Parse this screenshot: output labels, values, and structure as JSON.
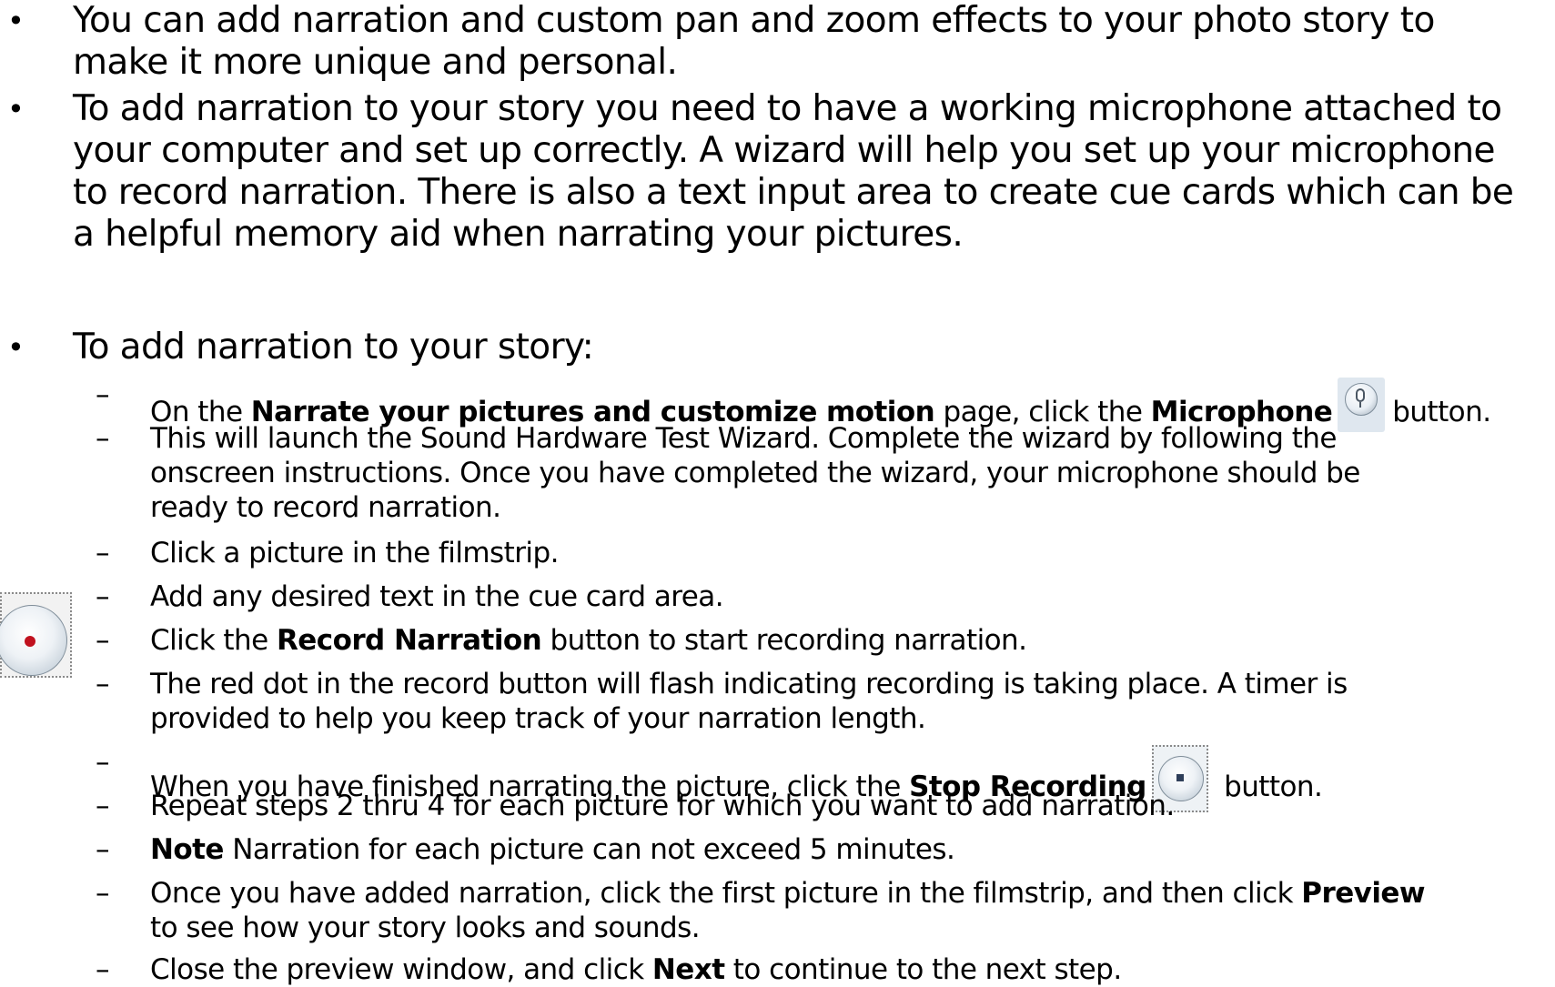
{
  "bullets_l1": [
    "You can add narration and custom pan and zoom effects to your photo story to\nmake it more unique and personal.",
    "To add narration to your story you need to have a working microphone attached to\nyour computer and set up correctly. A wizard will help you set up your microphone\nto record narration. There is also a text input area to create cue cards which can be\na helpful memory aid when narrating your pictures.",
    "To add narration to your story:"
  ],
  "bullet_symbol": "•",
  "dash_symbol": "–",
  "steps": {
    "s1": {
      "t1": "On the ",
      "b1": "Narrate your pictures and customize motion",
      "t2": " page, click the ",
      "b2": "Microphone",
      "t3": "button."
    },
    "s2": {
      "t1": "This will launch the Sound Hardware Test Wizard. Complete the wizard by following the\nonscreen instructions. Once you have completed the wizard, your microphone should be\nready to record narration."
    },
    "s3": {
      "t1": "Click a picture in the filmstrip."
    },
    "s4": {
      "t1": "Add any desired text in the cue card area."
    },
    "s5": {
      "t1": "Click the ",
      "b1": "Record Narration",
      "t2": "  button to start recording narration."
    },
    "s6": {
      "t1": "The red dot in the record button will flash indicating recording is taking place. A timer is\nprovided to help you keep track of your narration length."
    },
    "s7": {
      "t1": "When you have finished narrating the picture, click the ",
      "b1": "Stop Recording",
      "t2": " button."
    },
    "s8": {
      "t1": "Repeat steps 2 thru 4 for each picture for which you want to add narration."
    },
    "s9": {
      "b1": "Note",
      "t1": "   Narration for each picture can not exceed 5 minutes."
    },
    "s10": {
      "t1": "Once you have added narration, click the first picture in the filmstrip, and then click ",
      "b1": "Preview",
      "t2": "\nto see how your story looks and sounds."
    },
    "s11": {
      "t1": "Close the preview window, and click ",
      "b1": "Next",
      "t2": " to continue to the next step."
    }
  },
  "icons": {
    "microphone": "microphone-icon",
    "record": "record-narration-icon",
    "stop": "stop-recording-icon",
    "record_dot_color": "#c1121f"
  }
}
